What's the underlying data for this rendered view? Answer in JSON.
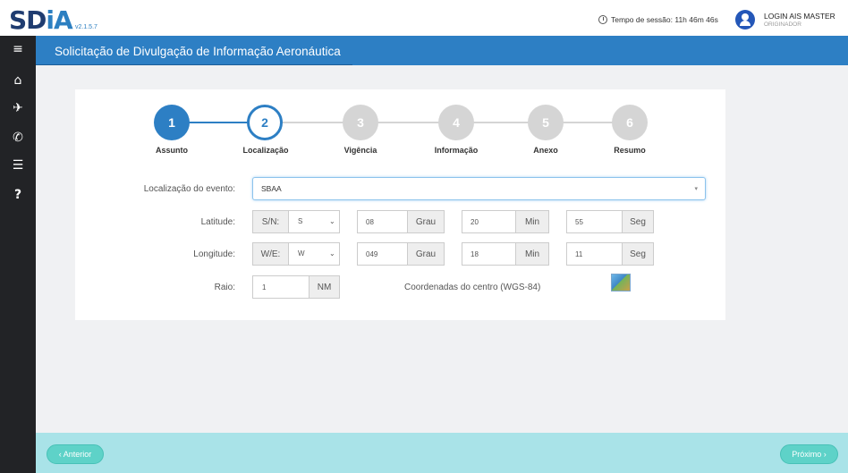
{
  "header": {
    "logo_main": "SD",
    "logo_accent": "iA",
    "version": "v2.1.5.7",
    "session_text": "Tempo de sessão: 11h 46m 46s",
    "user_name": "LOGIN AIS MASTER",
    "user_role": "ORIGINADOR"
  },
  "sidebar": {
    "icons": [
      {
        "name": "menu-icon",
        "glyph": "≡"
      },
      {
        "name": "home-icon",
        "glyph": "⌂"
      },
      {
        "name": "plane-icon",
        "glyph": "✈"
      },
      {
        "name": "phone-icon",
        "glyph": "✆"
      },
      {
        "name": "list-icon",
        "glyph": "☰"
      },
      {
        "name": "help-icon",
        "glyph": "?"
      }
    ]
  },
  "page": {
    "title": "Solicitação de Divulgação de Informação Aeronáutica"
  },
  "wizard": {
    "steps": [
      {
        "num": "1",
        "label": "Assunto",
        "state": "done"
      },
      {
        "num": "2",
        "label": "Localização",
        "state": "current"
      },
      {
        "num": "3",
        "label": "Vigência",
        "state": "pending"
      },
      {
        "num": "4",
        "label": "Informação",
        "state": "pending"
      },
      {
        "num": "5",
        "label": "Anexo",
        "state": "pending"
      },
      {
        "num": "6",
        "label": "Resumo",
        "state": "pending"
      }
    ],
    "colors": {
      "active": "#2d7fc4",
      "pending": "#d5d5d5"
    }
  },
  "form": {
    "location_label": "Localização do evento:",
    "location_value": "SBAA",
    "latitude_label": "Latitude:",
    "lat_hemi_label": "S/N:",
    "lat_hemi_value": "S",
    "lat_deg": "08",
    "lat_min": "20",
    "lat_sec": "55",
    "longitude_label": "Longitude:",
    "lon_hemi_label": "W/E:",
    "lon_hemi_value": "W",
    "lon_deg": "049",
    "lon_min": "18",
    "lon_sec": "11",
    "unit_deg": "Grau",
    "unit_min": "Min",
    "unit_sec": "Seg",
    "radius_label": "Raio:",
    "radius_value": "1",
    "radius_unit": "NM",
    "coords_label": "Coordenadas do centro (WGS-84)"
  },
  "footer": {
    "prev_label": "‹ Anterior",
    "next_label": "Próximo ›"
  }
}
